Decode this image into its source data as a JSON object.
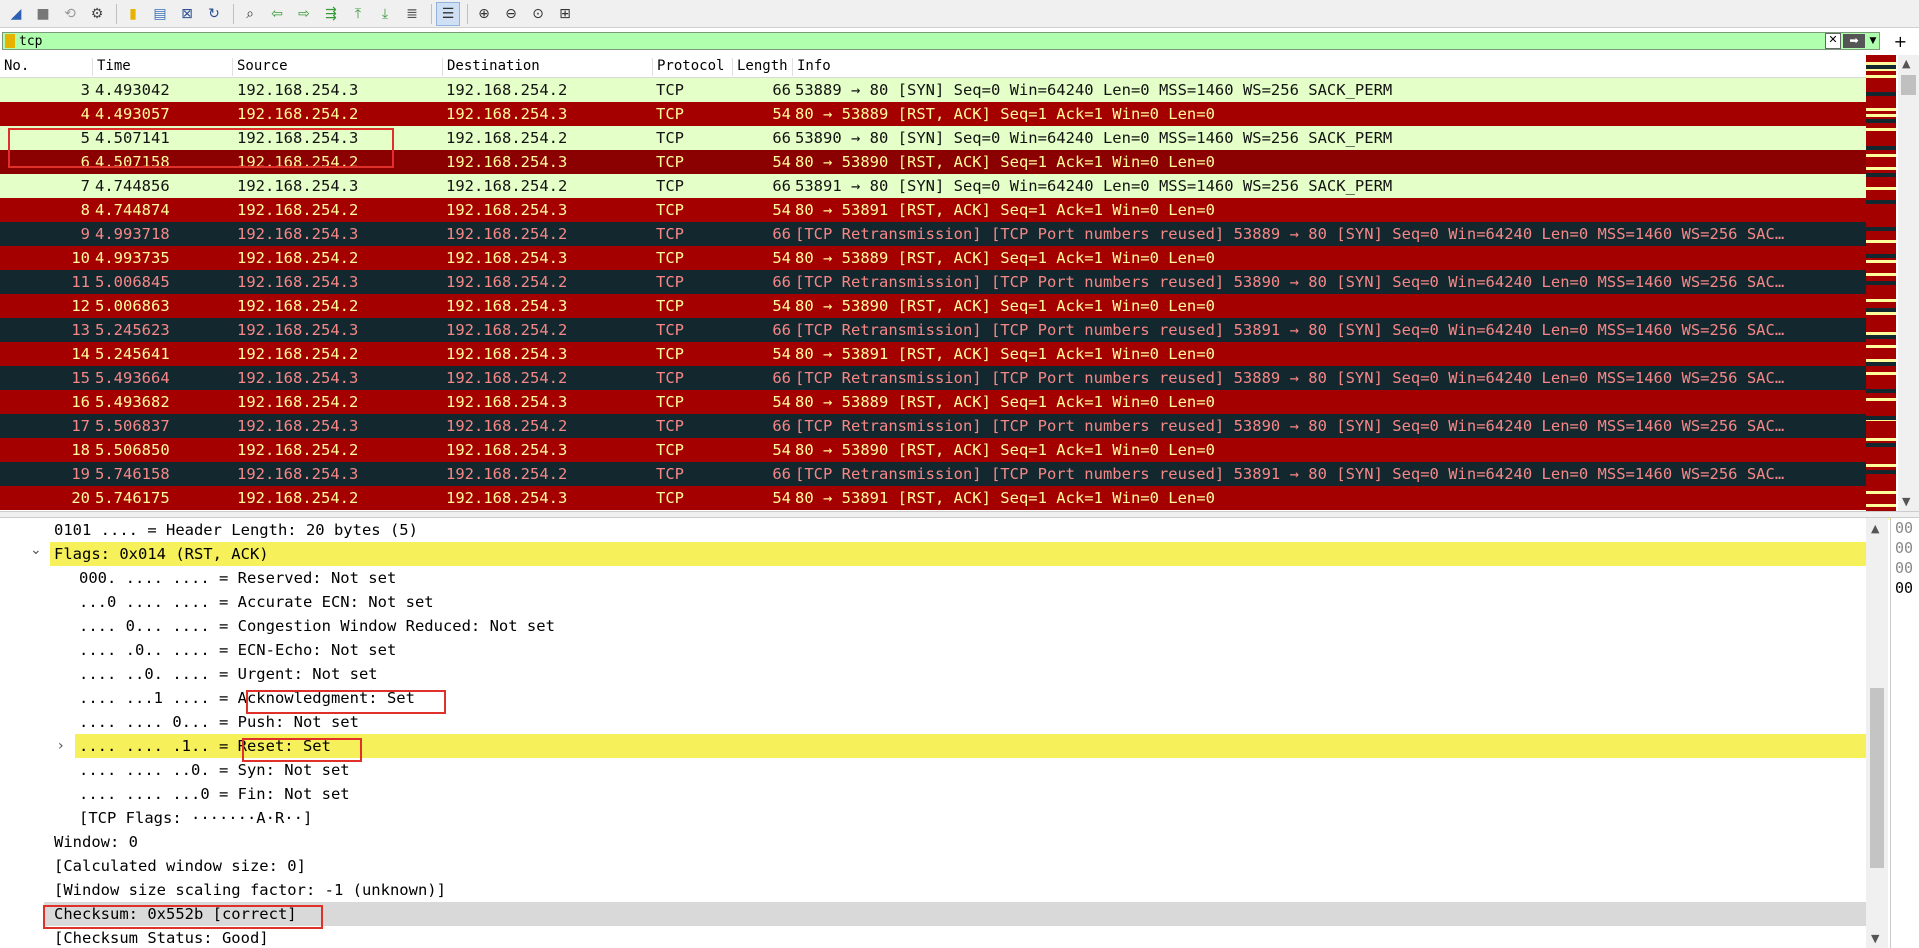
{
  "toolbar": {
    "icons": [
      "shark-fin-icon",
      "stop-icon",
      "restart-icon",
      "options-gear-icon",
      "open-folder-icon",
      "file-icon",
      "close-file-icon",
      "reload-icon",
      "find-icon",
      "back-arrow-icon",
      "forward-arrow-icon",
      "go-to-packet-icon",
      "first-packet-icon",
      "last-packet-icon",
      "autoscroll-icon",
      "colorize-icon",
      "zoom-in-icon",
      "zoom-out-icon",
      "zoom-normal-icon",
      "resize-columns-icon"
    ]
  },
  "filter": {
    "value": "tcp"
  },
  "columns": {
    "no": "No.",
    "time": "Time",
    "source": "Source",
    "destination": "Destination",
    "protocol": "Protocol",
    "length": "Length",
    "info": "Info"
  },
  "packets": [
    {
      "no": "3",
      "time": "4.493042",
      "src": "192.168.254.3",
      "dst": "192.168.254.2",
      "proto": "TCP",
      "len": "66",
      "info": "53889 → 80 [SYN] Seq=0 Win=64240 Len=0 MSS=1460 WS=256 SACK_PERM",
      "color": "syn"
    },
    {
      "no": "4",
      "time": "4.493057",
      "src": "192.168.254.2",
      "dst": "192.168.254.3",
      "proto": "TCP",
      "len": "54",
      "info": "80 → 53889 [RST, ACK] Seq=1 Ack=1 Win=0 Len=0",
      "color": "rst"
    },
    {
      "no": "5",
      "time": "4.507141",
      "src": "192.168.254.3",
      "dst": "192.168.254.2",
      "proto": "TCP",
      "len": "66",
      "info": "53890 → 80 [SYN] Seq=0 Win=64240 Len=0 MSS=1460 WS=256 SACK_PERM",
      "color": "syn"
    },
    {
      "no": "6",
      "time": "4.507158",
      "src": "192.168.254.2",
      "dst": "192.168.254.3",
      "proto": "TCP",
      "len": "54",
      "info": "80 → 53890 [RST, ACK] Seq=1 Ack=1 Win=0 Len=0",
      "color": "rst-sel"
    },
    {
      "no": "7",
      "time": "4.744856",
      "src": "192.168.254.3",
      "dst": "192.168.254.2",
      "proto": "TCP",
      "len": "66",
      "info": "53891 → 80 [SYN] Seq=0 Win=64240 Len=0 MSS=1460 WS=256 SACK_PERM",
      "color": "syn"
    },
    {
      "no": "8",
      "time": "4.744874",
      "src": "192.168.254.2",
      "dst": "192.168.254.3",
      "proto": "TCP",
      "len": "54",
      "info": "80 → 53891 [RST, ACK] Seq=1 Ack=1 Win=0 Len=0",
      "color": "rst"
    },
    {
      "no": "9",
      "time": "4.993718",
      "src": "192.168.254.3",
      "dst": "192.168.254.2",
      "proto": "TCP",
      "len": "66",
      "info": "[TCP Retransmission] [TCP Port numbers reused] 53889 → 80 [SYN] Seq=0 Win=64240 Len=0 MSS=1460 WS=256 SAC…",
      "color": "retr"
    },
    {
      "no": "10",
      "time": "4.993735",
      "src": "192.168.254.2",
      "dst": "192.168.254.3",
      "proto": "TCP",
      "len": "54",
      "info": "80 → 53889 [RST, ACK] Seq=1 Ack=1 Win=0 Len=0",
      "color": "rst"
    },
    {
      "no": "11",
      "time": "5.006845",
      "src": "192.168.254.3",
      "dst": "192.168.254.2",
      "proto": "TCP",
      "len": "66",
      "info": "[TCP Retransmission] [TCP Port numbers reused] 53890 → 80 [SYN] Seq=0 Win=64240 Len=0 MSS=1460 WS=256 SAC…",
      "color": "retr"
    },
    {
      "no": "12",
      "time": "5.006863",
      "src": "192.168.254.2",
      "dst": "192.168.254.3",
      "proto": "TCP",
      "len": "54",
      "info": "80 → 53890 [RST, ACK] Seq=1 Ack=1 Win=0 Len=0",
      "color": "rst"
    },
    {
      "no": "13",
      "time": "5.245623",
      "src": "192.168.254.3",
      "dst": "192.168.254.2",
      "proto": "TCP",
      "len": "66",
      "info": "[TCP Retransmission] [TCP Port numbers reused] 53891 → 80 [SYN] Seq=0 Win=64240 Len=0 MSS=1460 WS=256 SAC…",
      "color": "retr"
    },
    {
      "no": "14",
      "time": "5.245641",
      "src": "192.168.254.2",
      "dst": "192.168.254.3",
      "proto": "TCP",
      "len": "54",
      "info": "80 → 53891 [RST, ACK] Seq=1 Ack=1 Win=0 Len=0",
      "color": "rst"
    },
    {
      "no": "15",
      "time": "5.493664",
      "src": "192.168.254.3",
      "dst": "192.168.254.2",
      "proto": "TCP",
      "len": "66",
      "info": "[TCP Retransmission] [TCP Port numbers reused] 53889 → 80 [SYN] Seq=0 Win=64240 Len=0 MSS=1460 WS=256 SAC…",
      "color": "retr"
    },
    {
      "no": "16",
      "time": "5.493682",
      "src": "192.168.254.2",
      "dst": "192.168.254.3",
      "proto": "TCP",
      "len": "54",
      "info": "80 → 53889 [RST, ACK] Seq=1 Ack=1 Win=0 Len=0",
      "color": "rst"
    },
    {
      "no": "17",
      "time": "5.506837",
      "src": "192.168.254.3",
      "dst": "192.168.254.2",
      "proto": "TCP",
      "len": "66",
      "info": "[TCP Retransmission] [TCP Port numbers reused] 53890 → 80 [SYN] Seq=0 Win=64240 Len=0 MSS=1460 WS=256 SAC…",
      "color": "retr"
    },
    {
      "no": "18",
      "time": "5.506850",
      "src": "192.168.254.2",
      "dst": "192.168.254.3",
      "proto": "TCP",
      "len": "54",
      "info": "80 → 53890 [RST, ACK] Seq=1 Ack=1 Win=0 Len=0",
      "color": "rst"
    },
    {
      "no": "19",
      "time": "5.746158",
      "src": "192.168.254.3",
      "dst": "192.168.254.2",
      "proto": "TCP",
      "len": "66",
      "info": "[TCP Retransmission] [TCP Port numbers reused] 53891 → 80 [SYN] Seq=0 Win=64240 Len=0 MSS=1460 WS=256 SAC…",
      "color": "retr"
    },
    {
      "no": "20",
      "time": "5.746175",
      "src": "192.168.254.2",
      "dst": "192.168.254.3",
      "proto": "TCP",
      "len": "54",
      "info": "80 → 53891 [RST, ACK] Seq=1 Ack=1 Win=0 Len=0",
      "color": "rst"
    }
  ],
  "details": [
    {
      "text": "0101 .... = Header Length: 20 bytes (5)",
      "indent": 1,
      "twist": "",
      "style": ""
    },
    {
      "text": "Flags: 0x014 (RST, ACK)",
      "indent": 1,
      "twist": "open",
      "style": "hl"
    },
    {
      "text": "000. .... .... = Reserved: Not set",
      "indent": 2,
      "twist": "",
      "style": ""
    },
    {
      "text": "...0 .... .... = Accurate ECN: Not set",
      "indent": 2,
      "twist": "",
      "style": ""
    },
    {
      "text": ".... 0... .... = Congestion Window Reduced: Not set",
      "indent": 2,
      "twist": "",
      "style": ""
    },
    {
      "text": ".... .0.. .... = ECN-Echo: Not set",
      "indent": 2,
      "twist": "",
      "style": ""
    },
    {
      "text": ".... ..0. .... = Urgent: Not set",
      "indent": 2,
      "twist": "",
      "style": ""
    },
    {
      "text": ".... ...1 .... = Acknowledgment: Set",
      "indent": 2,
      "twist": "",
      "style": ""
    },
    {
      "text": ".... .... 0... = Push: Not set",
      "indent": 2,
      "twist": "",
      "style": ""
    },
    {
      "text": ".... .... .1.. = Reset: Set",
      "indent": 2,
      "twist": "closed",
      "style": "hl"
    },
    {
      "text": ".... .... ..0. = Syn: Not set",
      "indent": 2,
      "twist": "",
      "style": ""
    },
    {
      "text": ".... .... ...0 = Fin: Not set",
      "indent": 2,
      "twist": "",
      "style": ""
    },
    {
      "text": "[TCP Flags: ·······A·R··]",
      "indent": 2,
      "twist": "",
      "style": ""
    },
    {
      "text": "Window: 0",
      "indent": 1,
      "twist": "",
      "style": ""
    },
    {
      "text": "[Calculated window size: 0]",
      "indent": 1,
      "twist": "",
      "style": ""
    },
    {
      "text": "[Window size scaling factor: -1 (unknown)]",
      "indent": 1,
      "twist": "",
      "style": ""
    },
    {
      "text": "Checksum: 0x552b [correct]",
      "indent": 1,
      "twist": "",
      "style": "gray"
    },
    {
      "text": "[Checksum Status: Good]",
      "indent": 1,
      "twist": "",
      "style": ""
    }
  ],
  "bytes_pane": [
    "00",
    "00",
    "00",
    "00"
  ],
  "colors": {
    "syn_bg": "#e4ffc7",
    "rst_bg": "#a40000",
    "retr_bg": "#12272e",
    "filter_bg": "#afffaf",
    "highlight": "#f6f05a",
    "annotation_box": "#e0302a"
  }
}
